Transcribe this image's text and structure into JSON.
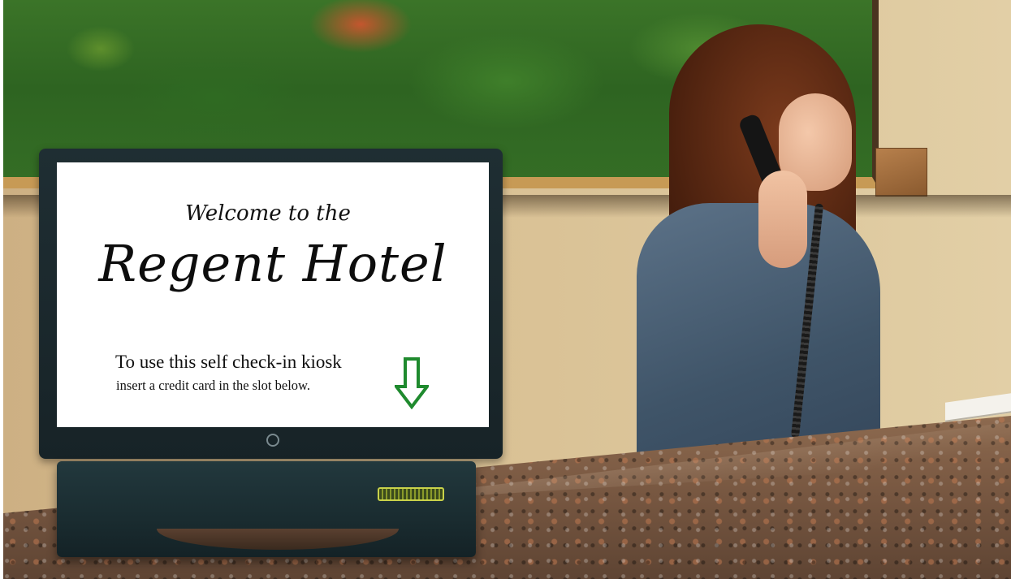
{
  "kiosk": {
    "welcome_line": "Welcome to the",
    "hotel_name": "Regent Hotel",
    "instruction_line_1": "To use this self check-in kiosk",
    "instruction_line_2": "insert a credit card in the slot below.",
    "arrow_color": "#1f8a2e",
    "indicator_color": "#c9d24a"
  },
  "icons": {
    "arrow": "arrow-down-icon",
    "kiosk_logo": "kiosk-logo-icon"
  }
}
